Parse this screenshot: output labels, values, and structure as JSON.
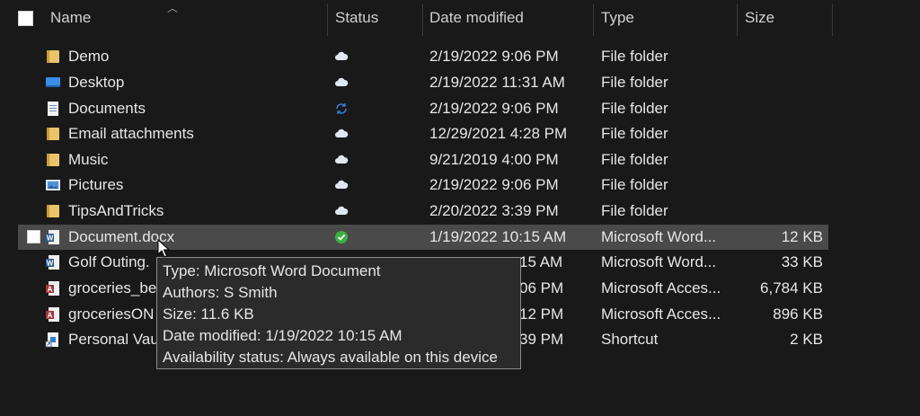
{
  "columns": {
    "name": "Name",
    "status": "Status",
    "date": "Date modified",
    "type": "Type",
    "size": "Size"
  },
  "rows": [
    {
      "name": "Demo",
      "status_icon": "cloud-icon",
      "date": "2/19/2022 9:06 PM",
      "type": "File folder",
      "size": "",
      "file_icon": "folder-icon"
    },
    {
      "name": "Desktop",
      "status_icon": "cloud-icon",
      "date": "2/19/2022 11:31 AM",
      "type": "File folder",
      "size": "",
      "file_icon": "desktop-folder-icon"
    },
    {
      "name": "Documents",
      "status_icon": "sync-icon",
      "date": "2/19/2022 9:06 PM",
      "type": "File folder",
      "size": "",
      "file_icon": "documents-folder-icon"
    },
    {
      "name": "Email attachments",
      "status_icon": "cloud-icon",
      "date": "12/29/2021 4:28 PM",
      "type": "File folder",
      "size": "",
      "file_icon": "folder-icon"
    },
    {
      "name": "Music",
      "status_icon": "cloud-icon",
      "date": "9/21/2019 4:00 PM",
      "type": "File folder",
      "size": "",
      "file_icon": "folder-icon"
    },
    {
      "name": "Pictures",
      "status_icon": "cloud-icon",
      "date": "2/19/2022 9:06 PM",
      "type": "File folder",
      "size": "",
      "file_icon": "pictures-folder-icon"
    },
    {
      "name": "TipsAndTricks",
      "status_icon": "cloud-icon",
      "date": "2/20/2022 3:39 PM",
      "type": "File folder",
      "size": "",
      "file_icon": "folder-icon"
    },
    {
      "name": "Document.docx",
      "status_icon": "available-check-icon",
      "date": "1/19/2022 10:15 AM",
      "type": "Microsoft Word...",
      "size": "12 KB",
      "file_icon": "word-document-icon",
      "selected": true
    },
    {
      "name": "Golf Outing.",
      "status_icon": "",
      "date": "15 AM",
      "type": "Microsoft Word...",
      "size": "33 KB",
      "file_icon": "word-document-icon"
    },
    {
      "name": "groceries_be",
      "status_icon": "",
      "date": "06 PM",
      "type": "Microsoft Acces...",
      "size": "6,784 KB",
      "file_icon": "access-database-icon"
    },
    {
      "name": "groceriesON",
      "status_icon": "",
      "date": "12 PM",
      "type": "Microsoft Acces...",
      "size": "896 KB",
      "file_icon": "access-database-icon"
    },
    {
      "name": "Personal Vau",
      "status_icon": "",
      "date": "39 PM",
      "type": "Shortcut",
      "size": "2 KB",
      "file_icon": "shortcut-icon"
    }
  ],
  "tooltip": {
    "type": "Type: Microsoft Word Document",
    "authors": "Authors: S Smith",
    "size": "Size: 11.6 KB",
    "modified": "Date modified: 1/19/2022 10:15 AM",
    "availability": "Availability status: Always available on this device"
  },
  "colors": {
    "background": "#191919",
    "selected_row": "#4a4a4a",
    "folder": "#e9c46a",
    "cloud": "#dfe7f2",
    "sync": "#2f7fd8",
    "available": "#3cb043",
    "word": "#2b5797",
    "access": "#a4373a"
  }
}
